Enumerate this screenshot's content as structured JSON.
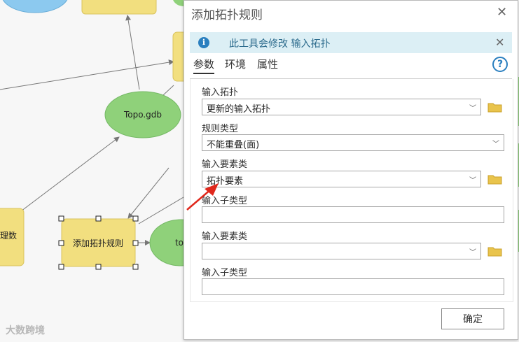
{
  "canvas": {
    "nodes": {
      "topo_gdb": "Topo.gdb",
      "add_rule": "添加拓扑规则",
      "left_partial": "理数",
      "to_partial": "to"
    },
    "watermark": "大数跨境"
  },
  "dialog": {
    "title": "添加拓扑规则",
    "info": "此工具会修改 输入拓扑",
    "tabs": [
      "参数",
      "环境",
      "属性"
    ],
    "help_glyph": "?",
    "fields": {
      "input_topology": {
        "label": "输入拓扑",
        "value": "更新的输入拓扑"
      },
      "rule_type": {
        "label": "规则类型",
        "value": "不能重叠(面)"
      },
      "input_feature_class": {
        "label": "输入要素类",
        "value": "拓扑要素"
      },
      "input_subtype": {
        "label": "输入子类型",
        "value": ""
      },
      "input_feature_class_2": {
        "label": "输入要素类",
        "value": ""
      },
      "input_subtype_2": {
        "label": "输入子类型",
        "value": ""
      }
    },
    "ok_label": "确定"
  },
  "colors": {
    "node_yellow": "#f2df7f",
    "node_green": "#8fd17a",
    "node_blue": "#8cc9ef",
    "info_bg": "#dceff5",
    "arrow_red": "#e0281c"
  },
  "icons": {
    "close": "close-icon",
    "info": "info-icon",
    "help": "help-icon",
    "folder": "folder-icon",
    "dropdown": "chevron-down-icon"
  }
}
